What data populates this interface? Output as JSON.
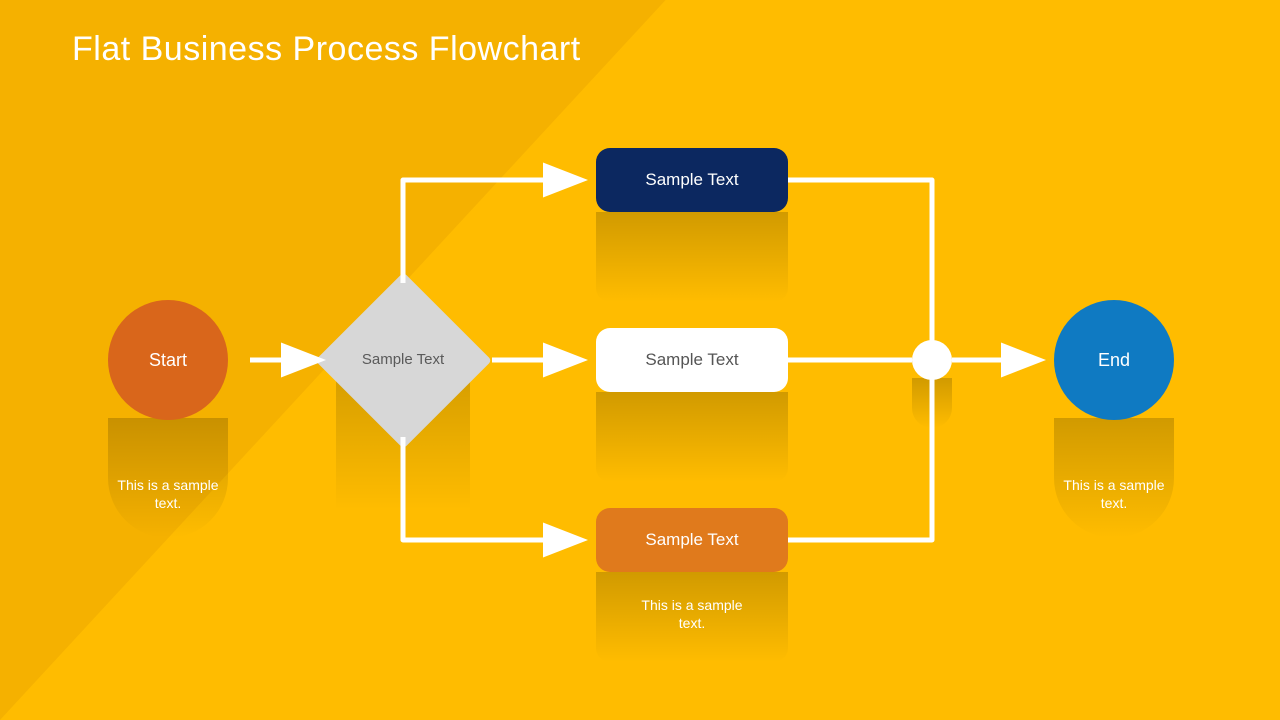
{
  "title": "Flat Business Process Flowchart",
  "start": {
    "label": "Start",
    "caption": "This is a sample text."
  },
  "end": {
    "label": "End",
    "caption": "This is a sample text."
  },
  "decision": {
    "label": "Sample Text"
  },
  "branches": {
    "top": {
      "label": "Sample Text"
    },
    "middle": {
      "label": "Sample Text"
    },
    "bottom": {
      "label": "Sample Text",
      "caption": "This is a sample text."
    }
  },
  "colors": {
    "bg_left": "#f5b100",
    "bg_right": "#ffbc00",
    "start": "#d9661b",
    "end": "#0f7ac2",
    "diamond": "#d7d7d7",
    "rect_top": "#0c2860",
    "rect_mid": "#ffffff",
    "rect_bot": "#e07a1c",
    "connector": "#ffffff"
  },
  "diagram": {
    "type": "flowchart",
    "nodes": [
      {
        "id": "start",
        "kind": "terminator",
        "label": "Start"
      },
      {
        "id": "decision",
        "kind": "decision",
        "label": "Sample Text"
      },
      {
        "id": "p1",
        "kind": "process",
        "label": "Sample Text"
      },
      {
        "id": "p2",
        "kind": "process",
        "label": "Sample Text"
      },
      {
        "id": "p3",
        "kind": "process",
        "label": "Sample Text"
      },
      {
        "id": "merge",
        "kind": "connector"
      },
      {
        "id": "end",
        "kind": "terminator",
        "label": "End"
      }
    ],
    "edges": [
      [
        "start",
        "decision"
      ],
      [
        "decision",
        "p1"
      ],
      [
        "decision",
        "p2"
      ],
      [
        "decision",
        "p3"
      ],
      [
        "p1",
        "merge"
      ],
      [
        "p2",
        "merge"
      ],
      [
        "p3",
        "merge"
      ],
      [
        "merge",
        "end"
      ]
    ]
  }
}
